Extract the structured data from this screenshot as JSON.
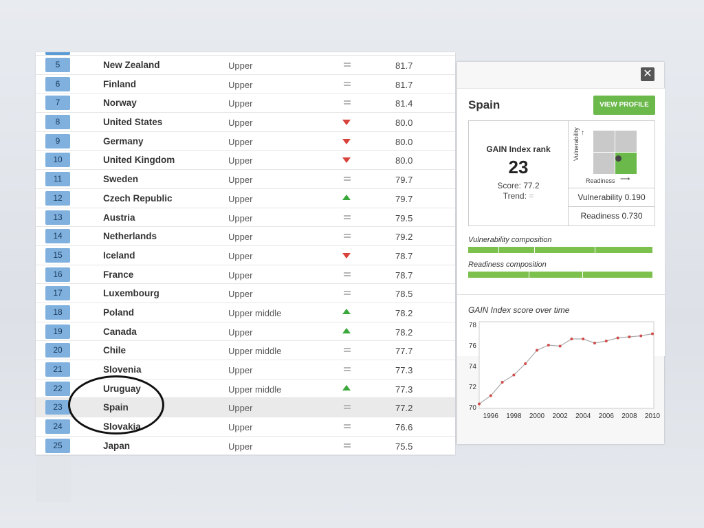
{
  "table": {
    "rows": [
      {
        "rank": "5",
        "country": "New Zealand",
        "income": "Upper",
        "trend": "eq",
        "score": "81.7"
      },
      {
        "rank": "6",
        "country": "Finland",
        "income": "Upper",
        "trend": "eq",
        "score": "81.7"
      },
      {
        "rank": "7",
        "country": "Norway",
        "income": "Upper",
        "trend": "eq",
        "score": "81.4"
      },
      {
        "rank": "8",
        "country": "United States",
        "income": "Upper",
        "trend": "down",
        "score": "80.0"
      },
      {
        "rank": "9",
        "country": "Germany",
        "income": "Upper",
        "trend": "down",
        "score": "80.0"
      },
      {
        "rank": "10",
        "country": "United Kingdom",
        "income": "Upper",
        "trend": "down",
        "score": "80.0"
      },
      {
        "rank": "11",
        "country": "Sweden",
        "income": "Upper",
        "trend": "eq",
        "score": "79.7"
      },
      {
        "rank": "12",
        "country": "Czech Republic",
        "income": "Upper",
        "trend": "up",
        "score": "79.7"
      },
      {
        "rank": "13",
        "country": "Austria",
        "income": "Upper",
        "trend": "eq",
        "score": "79.5"
      },
      {
        "rank": "14",
        "country": "Netherlands",
        "income": "Upper",
        "trend": "eq",
        "score": "79.2"
      },
      {
        "rank": "15",
        "country": "Iceland",
        "income": "Upper",
        "trend": "down",
        "score": "78.7"
      },
      {
        "rank": "16",
        "country": "France",
        "income": "Upper",
        "trend": "eq",
        "score": "78.7"
      },
      {
        "rank": "17",
        "country": "Luxembourg",
        "income": "Upper",
        "trend": "eq",
        "score": "78.5"
      },
      {
        "rank": "18",
        "country": "Poland",
        "income": "Upper middle",
        "trend": "up",
        "score": "78.2"
      },
      {
        "rank": "19",
        "country": "Canada",
        "income": "Upper",
        "trend": "up",
        "score": "78.2"
      },
      {
        "rank": "20",
        "country": "Chile",
        "income": "Upper middle",
        "trend": "eq",
        "score": "77.7"
      },
      {
        "rank": "21",
        "country": "Slovenia",
        "income": "Upper",
        "trend": "eq",
        "score": "77.3"
      },
      {
        "rank": "22",
        "country": "Uruguay",
        "income": "Upper middle",
        "trend": "up",
        "score": "77.3"
      },
      {
        "rank": "23",
        "country": "Spain",
        "income": "Upper",
        "trend": "eq",
        "score": "77.2",
        "highlight": true
      },
      {
        "rank": "24",
        "country": "Slovakia",
        "income": "Upper",
        "trend": "eq",
        "score": "76.6"
      },
      {
        "rank": "25",
        "country": "Japan",
        "income": "Upper",
        "trend": "eq",
        "score": "75.5"
      }
    ]
  },
  "detail": {
    "close_icon": "close-icon",
    "country": "Spain",
    "view_profile": "VIEW PROFILE",
    "rank_label": "GAIN Index rank",
    "rank": "23",
    "score_text": "Score: 77.2",
    "trend_label": "Trend:",
    "trend_symbol": "=",
    "vulnerability_axis": "Vulnerability",
    "readiness_axis": "Readiness",
    "vulnerability_text": "Vulnerability 0.190",
    "readiness_text": "Readiness 0.730",
    "vulnerability_composition": "Vulnerability composition",
    "readiness_composition": "Readiness composition",
    "chart_title": "GAIN Index score over time",
    "colors": {
      "green": "#6bb84b",
      "rank_blue": "#7fb0de",
      "line": "#aaaaaa",
      "point": "#d14b4b"
    }
  },
  "chart_data": {
    "type": "line",
    "title": "GAIN Index score over time",
    "x": [
      1995,
      1996,
      1997,
      1998,
      1999,
      2000,
      2001,
      2002,
      2003,
      2004,
      2005,
      2006,
      2007,
      2008,
      2009,
      2010
    ],
    "y": [
      70.3,
      71.1,
      72.4,
      73.1,
      74.2,
      75.5,
      76.0,
      75.9,
      76.6,
      76.6,
      76.2,
      76.4,
      76.7,
      76.8,
      76.9,
      77.1
    ],
    "xticks": [
      "1996",
      "1998",
      "2000",
      "2002",
      "2004",
      "2006",
      "2008",
      "2010"
    ],
    "yticks": [
      "70",
      "72",
      "74",
      "76",
      "78"
    ],
    "xlim": [
      1995,
      2010
    ],
    "ylim": [
      70,
      78
    ],
    "grid": false
  }
}
